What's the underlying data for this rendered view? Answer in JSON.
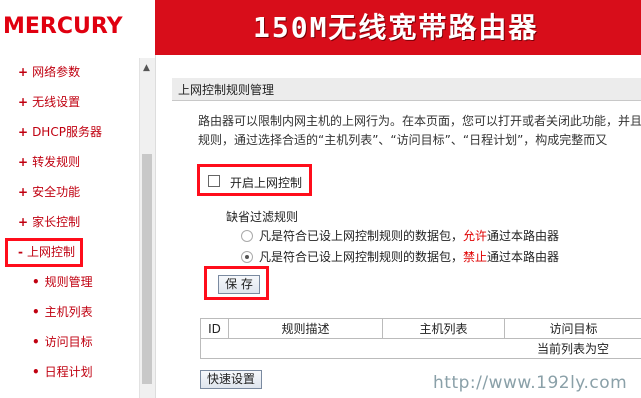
{
  "header": {
    "logo_text": "MERCURY",
    "title": "150M无线宽带路由器",
    "bar_color": "#d80d1a"
  },
  "sidebar": {
    "items": [
      {
        "label": "网络参数"
      },
      {
        "label": "无线设置"
      },
      {
        "label": "DHCP服务器"
      },
      {
        "label": "转发规则"
      },
      {
        "label": "安全功能"
      },
      {
        "label": "家长控制"
      },
      {
        "label": "上网控制"
      }
    ],
    "sub_items": [
      {
        "label": "规则管理"
      },
      {
        "label": "主机列表"
      },
      {
        "label": "访问目标"
      },
      {
        "label": "日程计划"
      }
    ]
  },
  "panel": {
    "title": "上网控制规则管理",
    "desc_line1": "路由器可以限制内网主机的上网行为。在本页面，您可以打开或者关闭此功能，并且",
    "desc_line2": "规则，通过选择合适的“主机列表”、“访问目标”、“日程计划”，构成完整而又",
    "enable_label": "开启上网控制",
    "enable_checked": false,
    "default_rule_title": "缺省过滤规则",
    "rule_allow_prefix": "凡是符合已设上网控制规则的数据包，",
    "rule_allow_word": "允许",
    "rule_allow_suffix": "通过本路由器",
    "rule_deny_prefix": "凡是符合已设上网控制规则的数据包，",
    "rule_deny_word": "禁止",
    "rule_deny_suffix": "通过本路由器",
    "selected_rule": "deny",
    "save_label": "保 存"
  },
  "table": {
    "headers": [
      "ID",
      "规则描述",
      "主机列表",
      "访问目标"
    ],
    "empty_text": "当前列表为空"
  },
  "quick_setup_label": "快速设置",
  "watermark": "http://www.192ly.com",
  "colors": {
    "accent_red": "#c00010",
    "highlight_box": "#ff0d1b"
  }
}
